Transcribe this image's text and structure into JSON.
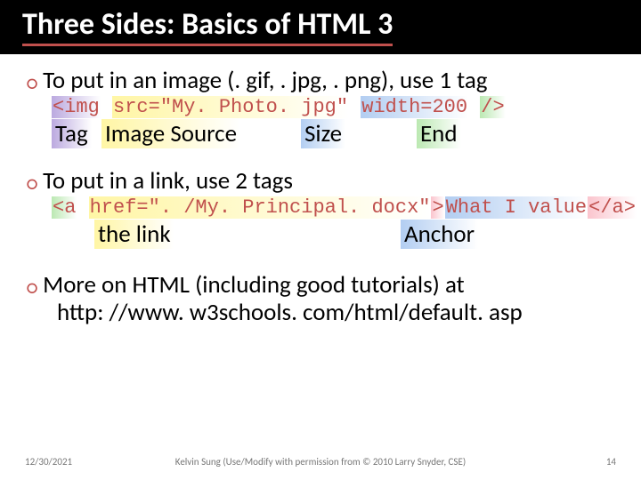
{
  "title": "Three Sides: Basics of HTML  3",
  "bullets": {
    "b1": "To put in an image (. gif, . jpg, . png), use 1 tag",
    "b2": "To put in a link, use 2 tags",
    "b3": "More on HTML (including good tutorials) at",
    "b3_sub": "http: //www. w3schools. com/html/default. asp"
  },
  "code1": {
    "tag_open": "<img",
    "space1": " ",
    "src": "src=\"My. Photo. jpg\"",
    "space2": " ",
    "width": "width=200",
    "space3": " ",
    "end": "/>"
  },
  "labels1": {
    "tag": "Tag",
    "source": "Image Source",
    "size": "Size",
    "end": "End"
  },
  "code2": {
    "open": "<a",
    "space1": " ",
    "href": "href=\". /My. Principal. docx\"",
    "gt": ">",
    "text": "What I value",
    "close": "</a>"
  },
  "labels2": {
    "link": "the link",
    "anchor": "Anchor"
  },
  "footer": {
    "date": "12/30/2021",
    "credit": "Kelvin Sung (Use/Modify with permission from © 2010 Larry Snyder, CSE)",
    "page": "14"
  }
}
